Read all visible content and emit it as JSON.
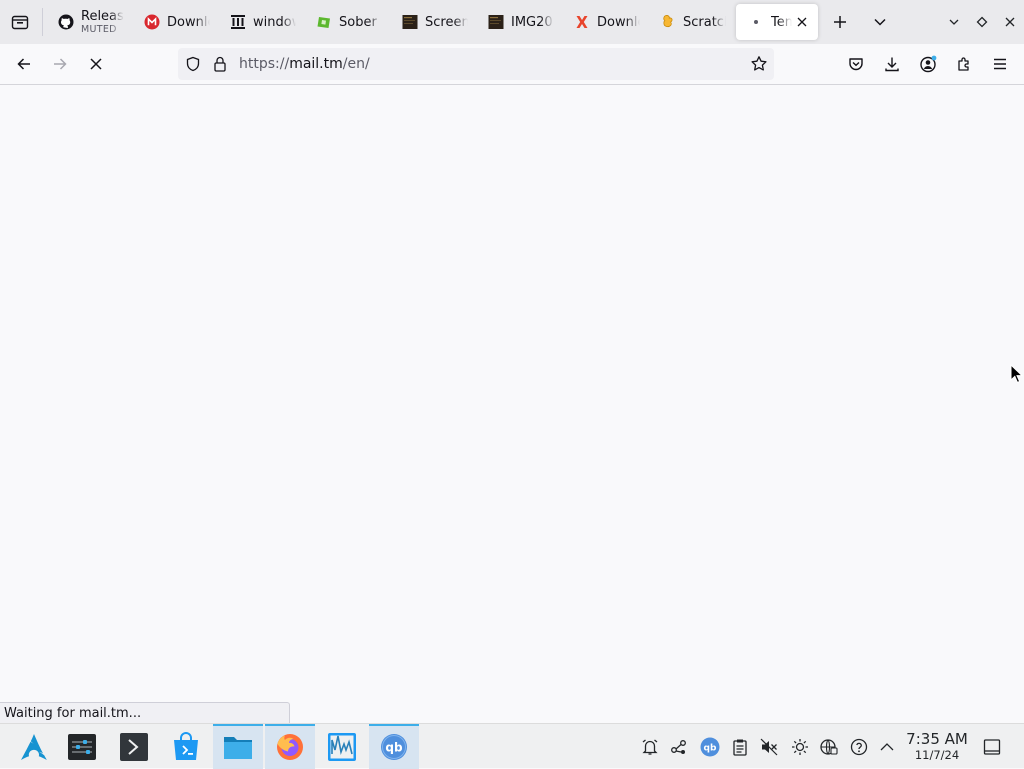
{
  "browser": {
    "tabs": [
      {
        "title": "Releases",
        "subtitle": "MUTED",
        "favicon": "github-icon"
      },
      {
        "title": "Download",
        "favicon": "mega-icon"
      },
      {
        "title": "windows",
        "favicon": "archive-org-icon"
      },
      {
        "title": "Sober",
        "favicon": "sober-icon"
      },
      {
        "title": "Screen",
        "favicon": "screen-thumbnail-icon"
      },
      {
        "title": "IMG20",
        "favicon": "image-thumbnail-icon"
      },
      {
        "title": "Download",
        "favicon": "x-download-icon"
      },
      {
        "title": "Scratch",
        "favicon": "scratch-icon"
      },
      {
        "title": "Temp",
        "favicon": "loading-dot-icon",
        "active": true
      }
    ],
    "url": {
      "scheme": "https://",
      "host": "mail.tm",
      "path": "/en/"
    },
    "status_text": "Waiting for mail.tm..."
  },
  "taskbar": {
    "clock_time": "7:35 AM",
    "clock_date": "11/7/24"
  },
  "colors": {
    "accent": "#3daee9",
    "content_bg": "#f9f9fb",
    "tabstrip_bg": "#eaeaed"
  }
}
